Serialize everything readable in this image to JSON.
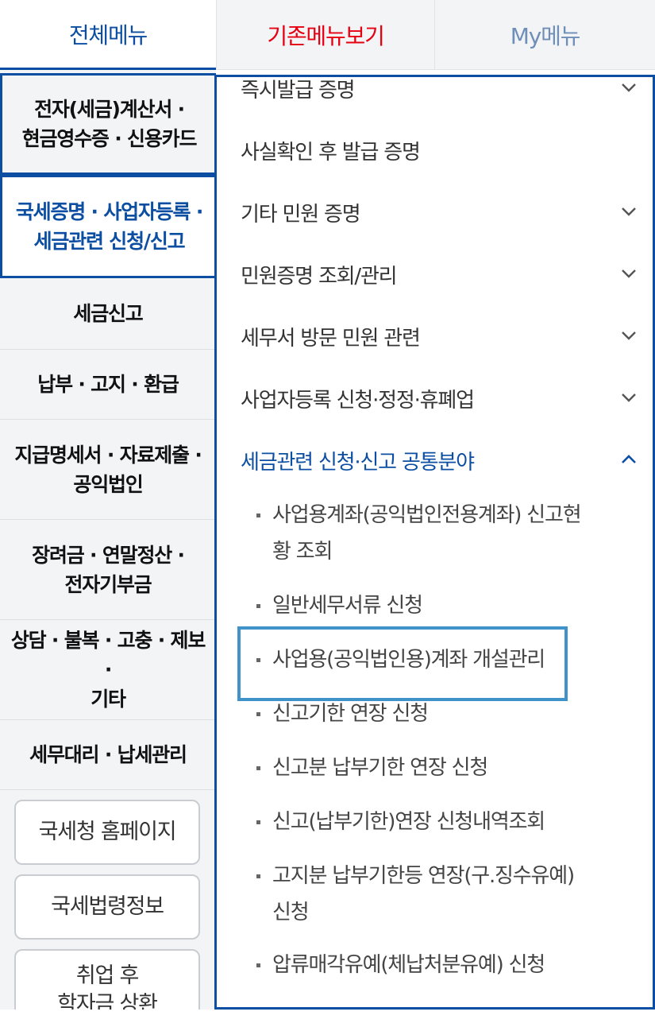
{
  "tabs": {
    "all_menu": "전체메뉴",
    "classic_menu": "기존메뉴보기",
    "my_menu": "My메뉴"
  },
  "categories": [
    {
      "label": "전자(세금)계산서 ·\n현금영수증 · 신용카드"
    },
    {
      "label": "국세증명 · 사업자등록 ·\n세금관련 신청/신고"
    },
    {
      "label": "세금신고"
    },
    {
      "label": "납부 · 고지 · 환급"
    },
    {
      "label": "지급명세서 · 자료제출 ·\n공익법인"
    },
    {
      "label": "장려금 · 연말정산 ·\n전자기부금"
    },
    {
      "label": "상담 · 불복 · 고충 · 제보 ·\n기타"
    },
    {
      "label": "세무대리 · 납세관리"
    }
  ],
  "link_buttons": [
    {
      "label": "국세청 홈페이지"
    },
    {
      "label": "국세법령정보"
    },
    {
      "label": "취업 후\n학자금 상환"
    }
  ],
  "menu": [
    {
      "label": "즉시발급 증명",
      "expandable": true
    },
    {
      "label": "사실확인 후 발급 증명",
      "expandable": false
    },
    {
      "label": "기타 민원 증명",
      "expandable": true
    },
    {
      "label": "민원증명 조회/관리",
      "expandable": true
    },
    {
      "label": "세무서 방문 민원 관련",
      "expandable": true
    },
    {
      "label": "사업자등록 신청·정정·휴폐업",
      "expandable": true
    },
    {
      "label": "세금관련 신청·신고 공통분야",
      "expandable": true,
      "open": true
    }
  ],
  "submenu": [
    {
      "label": "사업용계좌(공익법인전용계좌) 신고현황 조회"
    },
    {
      "label": "일반세무서류 신청"
    },
    {
      "label": "사업용(공익법인용)계좌 개설관리",
      "selected": true
    },
    {
      "label": "신고기한 연장 신청"
    },
    {
      "label": "신고분 납부기한 연장 신청"
    },
    {
      "label": "신고(납부기한)연장 신청내역조회"
    },
    {
      "label": "고지분 납부기한등 연장(구.징수유예) 신청"
    },
    {
      "label": "압류매각유예(체납처분유예) 신청"
    }
  ],
  "colors": {
    "primary_blue": "#0b4ea2",
    "classic_red": "#e60012",
    "highlight_border": "#3f93c9"
  }
}
